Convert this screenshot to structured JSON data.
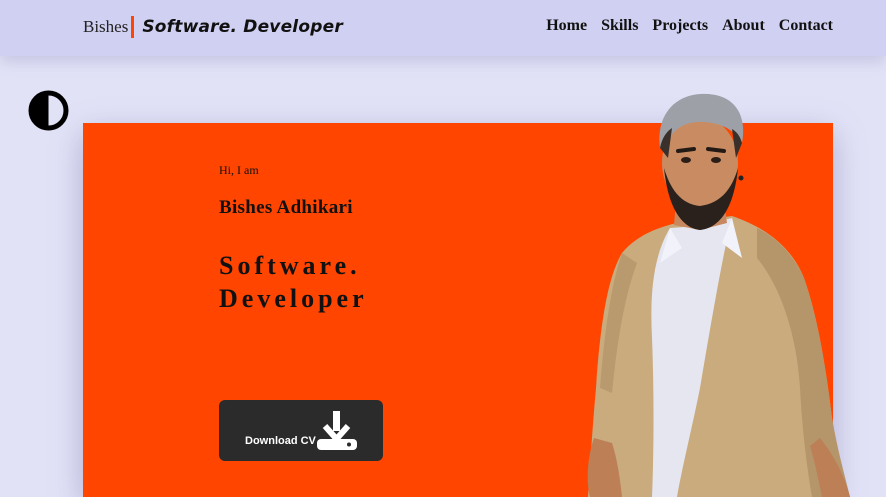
{
  "navbar": {
    "brand_name": "Bishes",
    "brand_role": "Software. Developer",
    "links": [
      "Home",
      "Skills",
      "Projects",
      "About",
      "Contact"
    ]
  },
  "theme_toggle": {
    "icon": "contrast-icon"
  },
  "hero": {
    "greeting": "Hi, I am",
    "name": "Bishes Adhikari",
    "role_line1": "Software.",
    "role_line2": "Developer",
    "cv_button": "Download CV",
    "cv_icon": "download-icon"
  },
  "colors": {
    "accent": "#ff4500",
    "navbar": "#d0d0f2",
    "background": "#e2e2f7",
    "button": "#2b2b2b"
  }
}
